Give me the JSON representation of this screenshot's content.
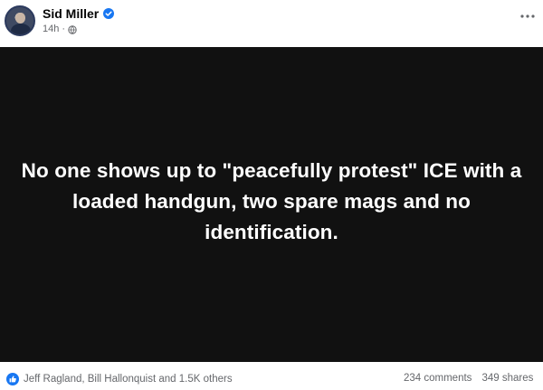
{
  "post": {
    "author": "Sid Miller",
    "time": "14h",
    "text": "No one shows up to \"peacefully protest\" ICE with a loaded handgun, two spare mags and no identification.",
    "reactions_text": "Jeff Ragland, Bill Hallonquist and 1.5K others",
    "comments_text": "234 comments",
    "shares_text": "349 shares"
  },
  "icons": {
    "verified": "verified-badge-icon",
    "audience": "globe-icon",
    "more": "more-options-icon",
    "like": "like-reaction-icon"
  },
  "colors": {
    "accent": "#1877f2",
    "media_background": "#111111",
    "secondary_text": "#65676b"
  }
}
